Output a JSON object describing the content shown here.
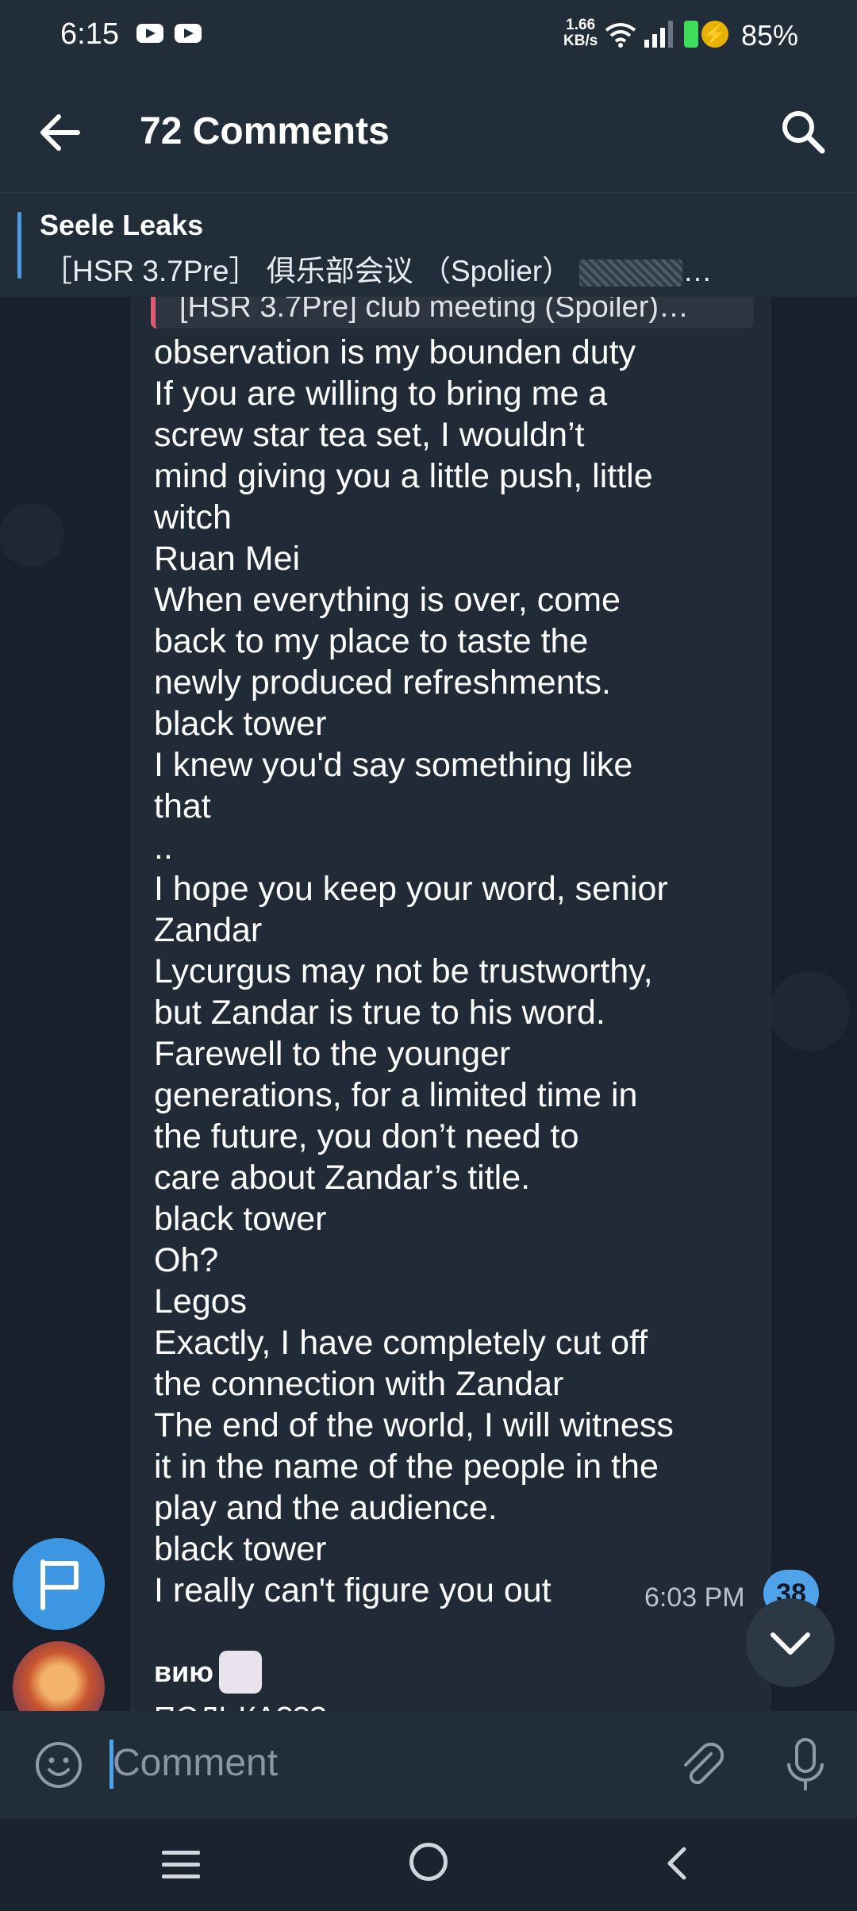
{
  "status_bar": {
    "time": "6:15",
    "net_speed_top": "1.66",
    "net_speed_bottom": "KB/s",
    "battery": "85%",
    "icons": [
      "youtube-icon",
      "youtube-icon",
      "wifi-icon",
      "signal-icon",
      "battery-icon",
      "charging-icon"
    ]
  },
  "header": {
    "title": "72 Comments",
    "back_icon": "arrow-left-icon",
    "search_icon": "search-icon"
  },
  "pinned": {
    "channel": "Seele Leaks",
    "preview": "［HSR 3.7Pre］ 俱乐部会议 （Spolier）"
  },
  "message": {
    "quote": "[HSR 3.7Pre] club meeting (Spoiler)…",
    "lines": [
      "observation is my bounden duty",
      "If you are willing to bring me a",
      "screw star tea set, I wouldn’t",
      "mind giving you a little push, little",
      "witch",
      "Ruan Mei",
      "When everything is over, come",
      "back to my place to taste the",
      "newly produced refreshments.",
      "black tower",
      "I knew you'd say something like",
      "that",
      "..",
      "I hope you keep your word, senior",
      "Zandar",
      "Lycurgus may not be trustworthy,",
      "but Zandar is true to his word.",
      "Farewell to the younger",
      "generations, for a limited time in",
      "the future, you don’t need to",
      "care about Zandar’s title.",
      "black tower",
      "Oh?",
      "Legos",
      "Exactly, I have completely cut off",
      "the connection with Zandar",
      "The end of the world, I will witness",
      "it in the name of the people in the",
      "play and the audience.",
      "black tower",
      "I really can't figure you out"
    ],
    "time": "6:03 PM"
  },
  "unread_badge": "38",
  "next_message": {
    "author": "вию",
    "text": "ПОЛЬКА???"
  },
  "input": {
    "placeholder": "Comment"
  }
}
